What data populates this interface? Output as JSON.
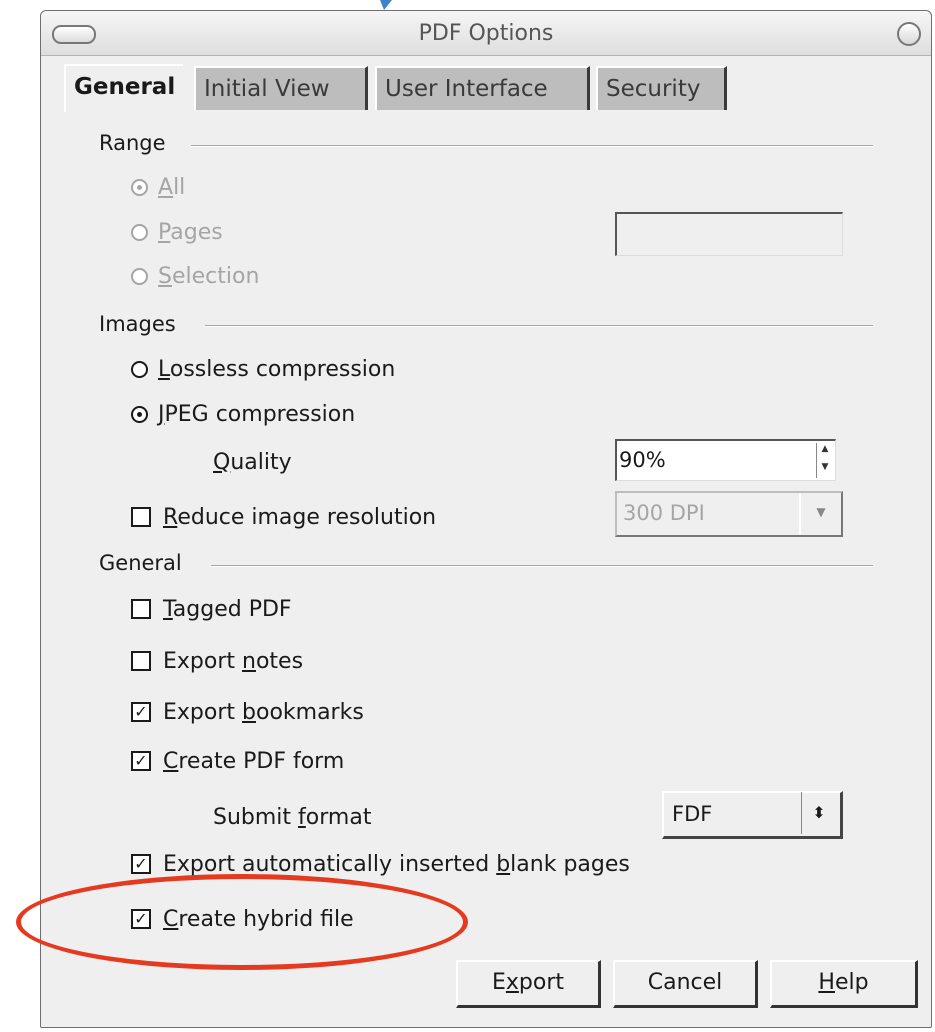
{
  "window": {
    "title": "PDF Options"
  },
  "tabs": [
    "General",
    "Initial View",
    "User Interface",
    "Security"
  ],
  "range": {
    "label": "Range",
    "options": [
      {
        "mnemonic": "A",
        "rest": "ll",
        "checked": true
      },
      {
        "mnemonic": "P",
        "rest": "ages",
        "checked": false
      },
      {
        "mnemonic": "S",
        "rest": "election",
        "checked": false
      }
    ],
    "pages_value": ""
  },
  "images": {
    "label": "Images",
    "lossless": {
      "mnemonic": "L",
      "rest": "ossless compression",
      "checked": false
    },
    "jpeg": {
      "mnemonic": "J",
      "rest": "PEG compression",
      "checked": true
    },
    "quality_label": {
      "mnemonic": "Q",
      "rest": "uality"
    },
    "quality_value": "90%",
    "reduce": {
      "mnemonic": "R",
      "rest": "educe image resolution",
      "checked": false
    },
    "resolution_value": "300 DPI"
  },
  "general": {
    "label": "General",
    "tagged_pdf": {
      "pre": "",
      "mnemonic": "T",
      "rest": "agged PDF",
      "checked": false
    },
    "export_notes": {
      "pre": "Export ",
      "mnemonic": "n",
      "rest": "otes",
      "checked": false
    },
    "export_bookmarks": {
      "pre": "Export ",
      "mnemonic": "b",
      "rest": "ookmarks",
      "checked": true
    },
    "create_form": {
      "pre": "",
      "mnemonic": "C",
      "rest": "reate PDF form",
      "checked": true
    },
    "submit_format_label": {
      "pre": "Submit ",
      "mnemonic": "f",
      "rest": "ormat"
    },
    "submit_format_value": "FDF",
    "export_blank": {
      "pre": "Export automatically inserted ",
      "mnemonic": "b",
      "rest": "lank pages",
      "checked": true
    },
    "hybrid": {
      "pre": "",
      "mnemonic": "C",
      "rest": "reate hybrid file",
      "checked": true
    }
  },
  "buttons": {
    "export": {
      "pre": "E",
      "mnemonic": "x",
      "rest": "port"
    },
    "cancel": "Cancel",
    "help": {
      "pre": "",
      "mnemonic": "H",
      "rest": "elp"
    }
  },
  "check_glyph": "✓",
  "colors": {
    "annotation": "#e53a1f"
  }
}
